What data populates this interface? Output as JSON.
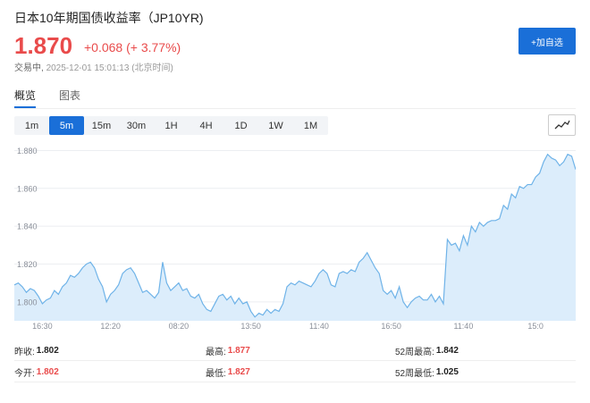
{
  "header": {
    "title": "日本10年期国债收益率（JP10YR)",
    "price": "1.870",
    "change": "+0.068 (+ 3.77%)",
    "status_label": "交易中,",
    "timestamp": "2025-12-01 15:01:13 (北京时间)",
    "add_button_label": "+加自选"
  },
  "tabs": [
    {
      "label": "概览",
      "active": true
    },
    {
      "label": "图表",
      "active": false
    }
  ],
  "periods": [
    {
      "label": "1m",
      "active": false
    },
    {
      "label": "5m",
      "active": true
    },
    {
      "label": "15m",
      "active": false
    },
    {
      "label": "30m",
      "active": false
    },
    {
      "label": "1H",
      "active": false
    },
    {
      "label": "4H",
      "active": false
    },
    {
      "label": "1D",
      "active": false
    },
    {
      "label": "1W",
      "active": false
    },
    {
      "label": "1M",
      "active": false
    }
  ],
  "chart_type_icon": "line-chart-icon",
  "colors": {
    "accent": "#1a6fd8",
    "up": "#e94b4b",
    "line": "#6fb3e8",
    "fill": "#dcedfb"
  },
  "chart_data": {
    "type": "area",
    "ylim": [
      1.79,
      1.884
    ],
    "y_ticks": [
      "1.880",
      "1.860",
      "1.840",
      "1.820",
      "1.800"
    ],
    "y_tick_values": [
      1.88,
      1.86,
      1.84,
      1.82,
      1.8
    ],
    "x_tick_labels": [
      "16:30",
      "12:20",
      "08:20",
      "13:50",
      "11:40",
      "16:50",
      "11:40",
      "15:0"
    ],
    "x_tick_index": [
      7,
      24,
      41,
      59,
      76,
      94,
      112,
      130
    ],
    "values": [
      1.809,
      1.81,
      1.808,
      1.805,
      1.807,
      1.806,
      1.803,
      1.799,
      1.801,
      1.802,
      1.806,
      1.804,
      1.808,
      1.81,
      1.814,
      1.813,
      1.815,
      1.818,
      1.82,
      1.821,
      1.818,
      1.812,
      1.808,
      1.8,
      1.804,
      1.806,
      1.809,
      1.815,
      1.817,
      1.818,
      1.815,
      1.81,
      1.805,
      1.806,
      1.804,
      1.802,
      1.805,
      1.821,
      1.81,
      1.806,
      1.808,
      1.81,
      1.806,
      1.807,
      1.803,
      1.802,
      1.804,
      1.799,
      1.796,
      1.795,
      1.799,
      1.803,
      1.804,
      1.801,
      1.803,
      1.799,
      1.802,
      1.799,
      1.8,
      1.795,
      1.792,
      1.794,
      1.793,
      1.796,
      1.794,
      1.796,
      1.795,
      1.799,
      1.808,
      1.81,
      1.809,
      1.811,
      1.81,
      1.809,
      1.808,
      1.811,
      1.815,
      1.817,
      1.815,
      1.809,
      1.808,
      1.815,
      1.816,
      1.815,
      1.817,
      1.816,
      1.821,
      1.823,
      1.826,
      1.822,
      1.818,
      1.815,
      1.806,
      1.804,
      1.806,
      1.802,
      1.808,
      1.8,
      1.797,
      1.8,
      1.802,
      1.803,
      1.801,
      1.801,
      1.804,
      1.8,
      1.803,
      1.799,
      1.833,
      1.83,
      1.831,
      1.827,
      1.835,
      1.83,
      1.84,
      1.837,
      1.842,
      1.84,
      1.842,
      1.843,
      1.843,
      1.844,
      1.851,
      1.849,
      1.857,
      1.855,
      1.861,
      1.86,
      1.862,
      1.862,
      1.866,
      1.868,
      1.874,
      1.878,
      1.876,
      1.875,
      1.872,
      1.874,
      1.878,
      1.877,
      1.87
    ]
  },
  "stats": [
    [
      {
        "label": "昨收:",
        "value": "1.802",
        "red": false
      },
      {
        "label": "最高:",
        "value": "1.877",
        "red": true
      },
      {
        "label": "52周最高:",
        "value": "1.842",
        "red": false
      }
    ],
    [
      {
        "label": "今开:",
        "value": "1.802",
        "red": true
      },
      {
        "label": "最低:",
        "value": "1.827",
        "red": true
      },
      {
        "label": "52周最低:",
        "value": "1.025",
        "red": false
      }
    ]
  ]
}
